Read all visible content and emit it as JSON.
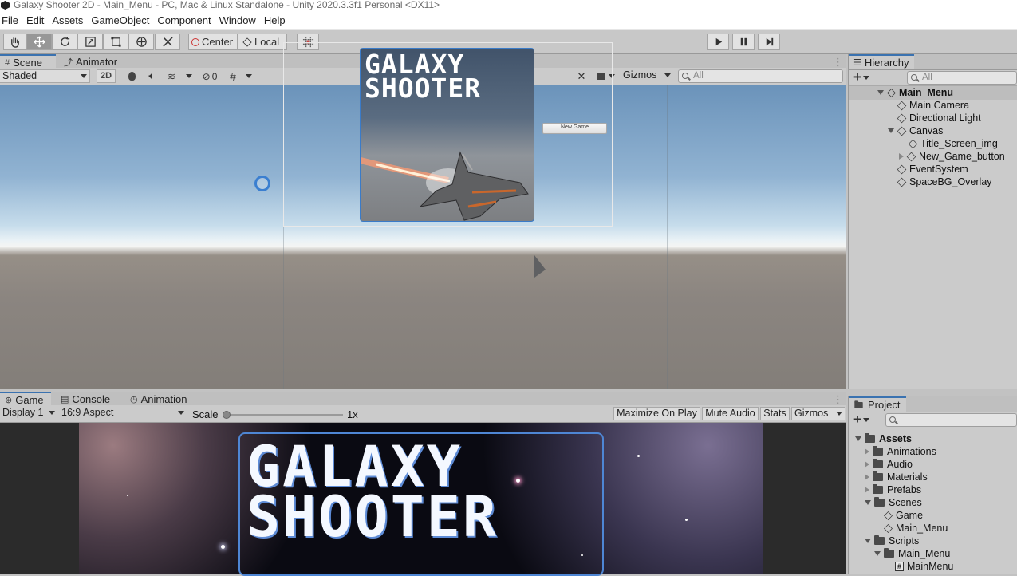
{
  "window": {
    "title": "Galaxy Shooter 2D - Main_Menu - PC, Mac & Linux Standalone - Unity 2020.3.3f1 Personal <DX11>"
  },
  "menu": [
    "File",
    "Edit",
    "Assets",
    "GameObject",
    "Component",
    "Window",
    "Help"
  ],
  "toolbar": {
    "pivot_label": "Center",
    "space_label": "Local"
  },
  "scene_tabs": [
    {
      "label": "Scene"
    },
    {
      "label": "Animator"
    }
  ],
  "scene_controls": {
    "shading": "Shaded",
    "mode_2d": "2D",
    "hidden_count": "0",
    "gizmos": "Gizmos",
    "search_placeholder": "All"
  },
  "scene_view": {
    "title_line1": "GALAXY",
    "title_line2": "SHOOTER",
    "button_text": "New Game"
  },
  "hierarchy": {
    "tab": "Hierarchy",
    "search_placeholder": "All",
    "scene": "Main_Menu",
    "items": [
      "Main Camera",
      "Directional Light",
      "Canvas",
      "Title_Screen_img",
      "New_Game_button",
      "EventSystem",
      "SpaceBG_Overlay"
    ]
  },
  "game_tabs": [
    {
      "label": "Game"
    },
    {
      "label": "Console"
    },
    {
      "label": "Animation"
    }
  ],
  "game_controls": {
    "display": "Display 1",
    "aspect": "16:9 Aspect",
    "scale_label": "Scale",
    "scale_value": "1x",
    "maximize": "Maximize On Play",
    "mute": "Mute Audio",
    "stats": "Stats",
    "gizmos": "Gizmos"
  },
  "game_view": {
    "title_line1": "GALAXY",
    "title_line2": "SHOOTER"
  },
  "project": {
    "tab": "Project",
    "root": "Assets",
    "folders": [
      "Animations",
      "Audio",
      "Materials",
      "Prefabs",
      "Scenes"
    ],
    "scenes": [
      "Game",
      "Main_Menu"
    ],
    "scripts_folder": "Scripts",
    "scripts_sub": "Main_Menu",
    "script_file": "MainMenu"
  }
}
